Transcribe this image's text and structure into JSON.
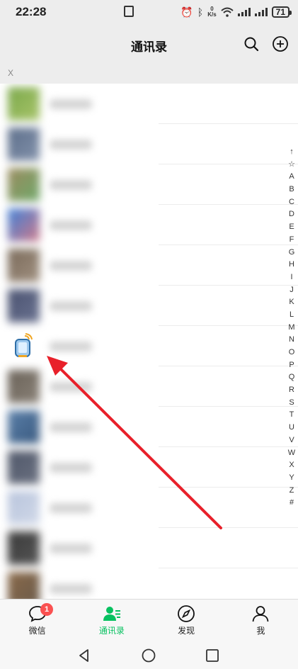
{
  "status_bar": {
    "time": "22:28",
    "net_speed_value": "0",
    "net_speed_unit": "K/s",
    "battery": "71"
  },
  "header": {
    "title": "通讯录",
    "search_icon": "search-icon",
    "add_icon": "plus-circle-icon"
  },
  "list_hint": "X",
  "contacts": [
    {
      "avatar_color": "#7aa84a",
      "avatar_color2": "#a8c46a"
    },
    {
      "avatar_color": "#5c6e8a",
      "avatar_color2": "#8392ab"
    },
    {
      "avatar_color": "#9a8a5e",
      "avatar_color2": "#6fa86a"
    },
    {
      "avatar_color": "#3d7fd6",
      "avatar_color2": "#d07a8a"
    },
    {
      "avatar_color": "#7a6a5a",
      "avatar_color2": "#a09080"
    },
    {
      "avatar_color": "#4a5270",
      "avatar_color2": "#6a7290"
    },
    {
      "avatar_color": "special",
      "avatar_color2": "special"
    },
    {
      "avatar_color": "#6a6258",
      "avatar_color2": "#8a8278"
    },
    {
      "avatar_color": "#5a7fa8",
      "avatar_color2": "#3a5a80"
    },
    {
      "avatar_color": "#50586a",
      "avatar_color2": "#6a7080"
    },
    {
      "avatar_color": "#b8c4dc",
      "avatar_color2": "#d0d8e8"
    },
    {
      "avatar_color": "#3a3a3a",
      "avatar_color2": "#555555"
    },
    {
      "avatar_color": "#8a6a4a",
      "avatar_color2": "#6a5a4a"
    }
  ],
  "alphabet_index": [
    "↑",
    "☆",
    "A",
    "B",
    "C",
    "D",
    "E",
    "F",
    "G",
    "H",
    "I",
    "J",
    "K",
    "L",
    "M",
    "N",
    "O",
    "P",
    "Q",
    "R",
    "S",
    "T",
    "U",
    "V",
    "W",
    "X",
    "Y",
    "Z",
    "#"
  ],
  "tabs": [
    {
      "label": "微信",
      "icon": "chat-bubble-icon",
      "badge": "1",
      "active": false
    },
    {
      "label": "通讯录",
      "icon": "contacts-icon",
      "active": true
    },
    {
      "label": "发现",
      "icon": "compass-icon",
      "active": false
    },
    {
      "label": "我",
      "icon": "person-icon",
      "active": false
    }
  ],
  "colors": {
    "accent": "#07c160",
    "badge": "#fa5151",
    "annotation_arrow": "#e8202a"
  },
  "system_nav": [
    "back-icon",
    "home-icon",
    "recents-icon"
  ]
}
